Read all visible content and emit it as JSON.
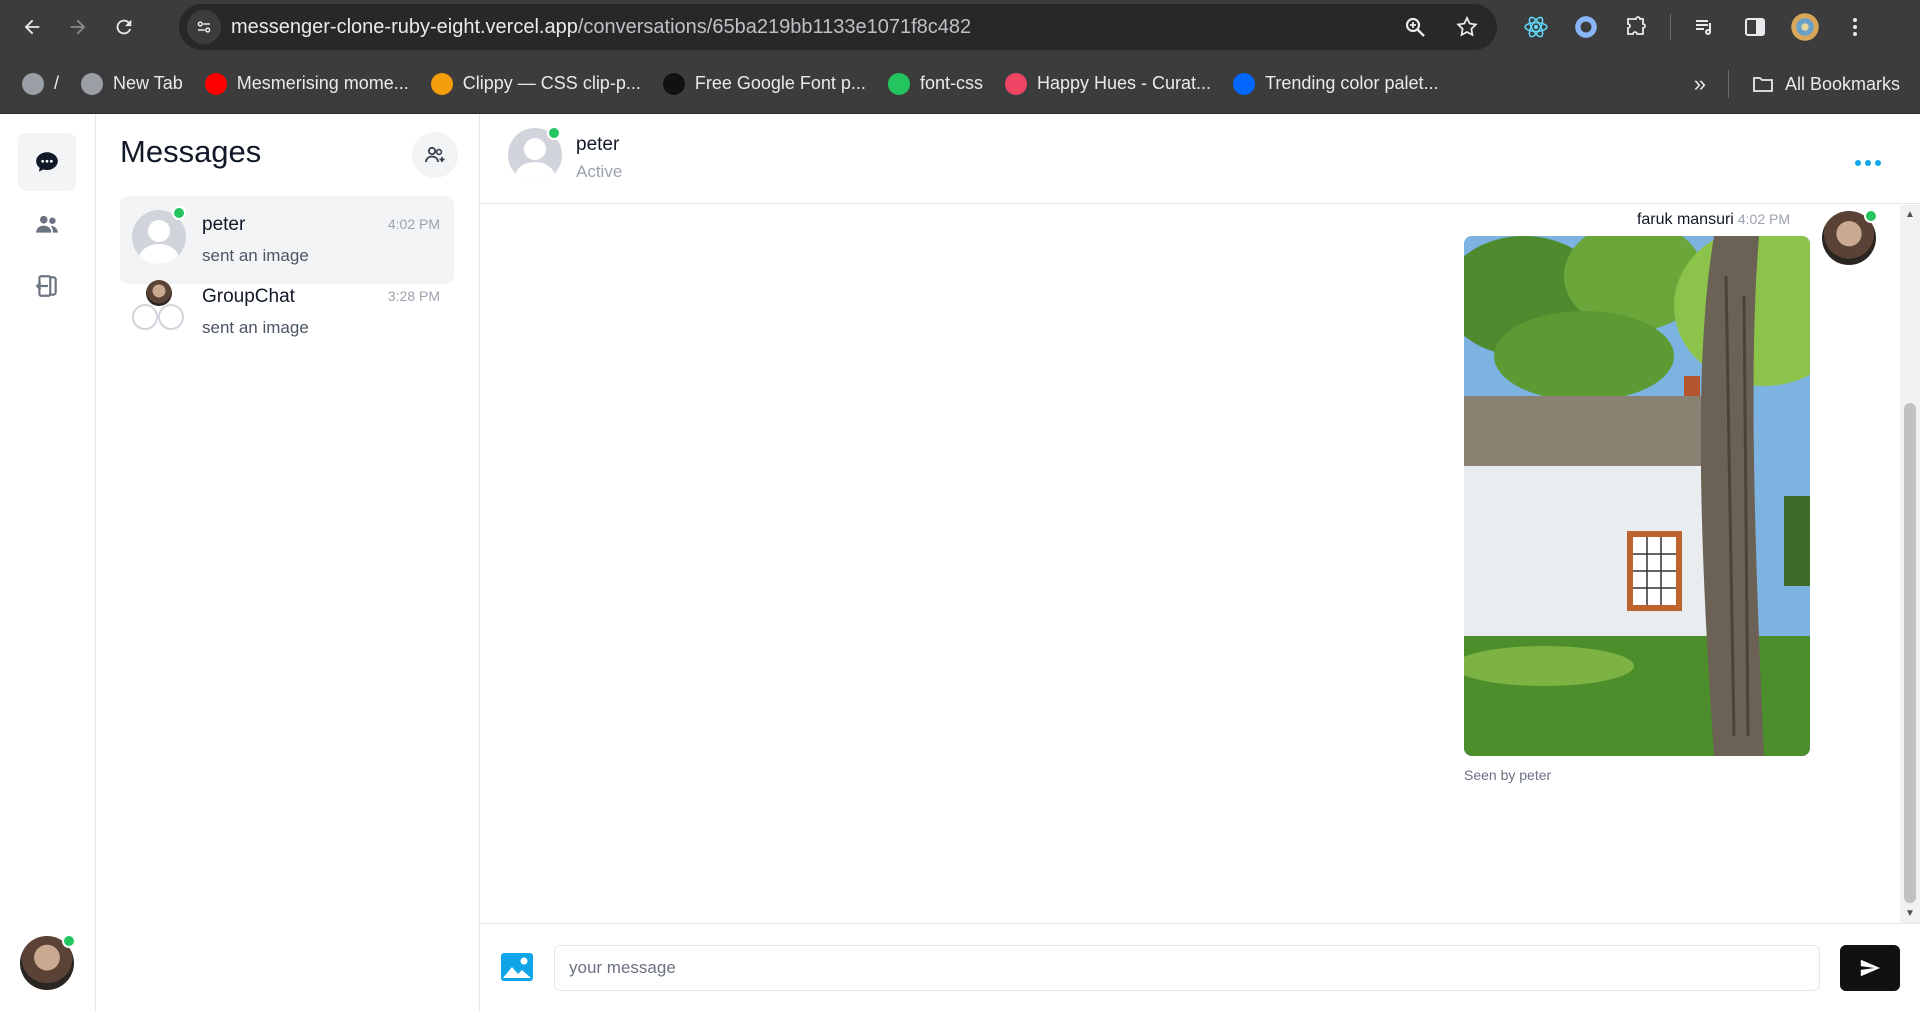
{
  "browser": {
    "url_host": "messenger-clone-ruby-eight.vercel.app",
    "url_path": "/conversations/65ba219bb1133e1071f8c482",
    "bookmarks": [
      {
        "label": "/",
        "icon": "globe-icon",
        "color": "#9aa0a6"
      },
      {
        "label": "New Tab",
        "icon": "globe-icon",
        "color": "#9aa0a6"
      },
      {
        "label": "Mesmerising mome...",
        "icon": "youtube-icon",
        "color": "#ff0000"
      },
      {
        "label": "Clippy — CSS clip-p...",
        "icon": "clippy-icon",
        "color": "#f59e0b"
      },
      {
        "label": "Free Google Font p...",
        "icon": "fontpair-icon",
        "color": "#111111"
      },
      {
        "label": "font-css",
        "icon": "font-css-icon",
        "color": "#22c55e"
      },
      {
        "label": "Happy Hues - Curat...",
        "icon": "happy-hues-icon",
        "color": "#ef4565"
      },
      {
        "label": "Trending color palet...",
        "icon": "coolors-icon",
        "color": "#0066ff"
      }
    ],
    "all_bookmarks_label": "All Bookmarks"
  },
  "sidebar": {
    "title": "Messages"
  },
  "conversations": [
    {
      "name": "peter",
      "time": "4:02 PM",
      "last_message": "sent an image",
      "selected": true,
      "online": true
    },
    {
      "name": "GroupChat",
      "time": "3:28 PM",
      "last_message": "sent an image",
      "selected": false,
      "online": false
    }
  ],
  "chat": {
    "name": "peter",
    "status": "Active",
    "message": {
      "sender": "faruk mansuri",
      "time": "4:02 PM",
      "seen": "Seen by peter"
    },
    "composer": {
      "placeholder": "your message"
    }
  },
  "colors": {
    "online": "#22c55e",
    "accent": "#0ea5e9",
    "send_button": "#111111"
  }
}
